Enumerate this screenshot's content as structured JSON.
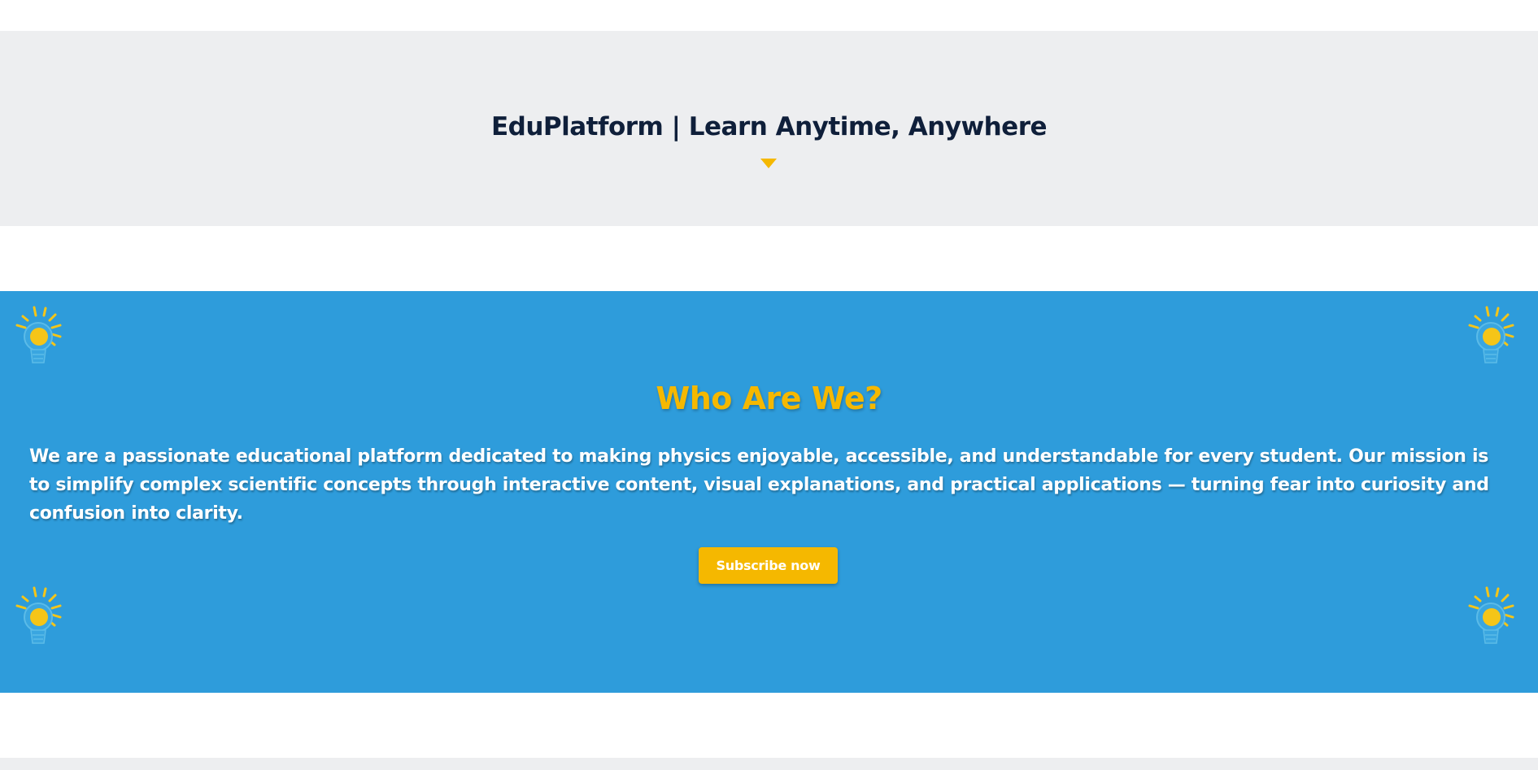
{
  "header": {
    "title": "EduPlatform | Learn Anytime, Anywhere"
  },
  "about": {
    "heading": "Who Are We?",
    "description": "We are a passionate educational platform dedicated to making physics enjoyable, accessible, and understandable for every student. Our mission is to simplify complex scientific concepts through interactive content, visual explanations, and practical applications — turning fear into curiosity and confusion into clarity.",
    "subscribe_label": "Subscribe now"
  },
  "decorations": {
    "corner_icon": "lightbulb-icon"
  },
  "colors": {
    "accent": "#f5b800",
    "section_blue": "#2e9cdb",
    "light_band": "#edeef0",
    "title_dark": "#0f1f3a"
  }
}
